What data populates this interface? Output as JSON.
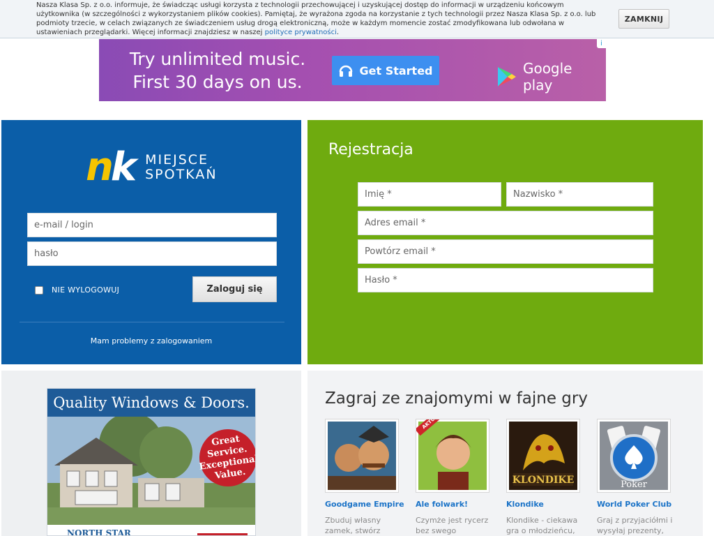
{
  "cookie_bar": {
    "text": "Nasza Klasa Sp. z o.o. informuje, że świadcząc usługi korzysta z technologii przechowującej i uzyskującej dostęp do informacji w urządzeniu końcowym użytkownika (w szczególności z wykorzystaniem plików cookies). Pamiętaj, że wyrażona zgoda na korzystanie z tych technologii przez Nasza Klasa Sp. z o.o. lub podmioty trzecie, w celach związanych ze świadczeniem usług drogą elektroniczną, może w każdym momencie zostać zmodyfikowana lub odwołana w ustawieniach przeglądarki. Więcej informacji znajdziesz w naszej",
    "link": "polityce prywatności",
    "link_suffix": ".",
    "close_label": "ZAMKNIJ"
  },
  "ad_banner": {
    "line1": "Try unlimited music.",
    "line2": "First 30 days on us.",
    "cta": "Get Started",
    "store": "Google play",
    "info_icon": "info-icon"
  },
  "login": {
    "logo_line1": "MIEJSCE",
    "logo_line2": "SPOTKAŃ",
    "email_placeholder": "e-mail / login",
    "password_placeholder": "hasło",
    "remember_label": "NIE WYLOGOWUJ",
    "login_button": "Zaloguj się",
    "problem_link": "Mam problemy z zalogowaniem",
    "colors": {
      "panel": "#0b5ea8",
      "logo_n": "#f5c400"
    }
  },
  "register": {
    "title": "Rejestracja",
    "first_name": "Imię *",
    "last_name": "Nazwisko *",
    "email": "Adres email *",
    "email_repeat": "Powtórz email *",
    "password": "Hasło *",
    "colors": {
      "panel": "#6fab0f"
    }
  },
  "windows_ad": {
    "headline": "Quality Windows & Doors.",
    "badge_line1": "Great",
    "badge_line2": "Service.",
    "badge_line3": "Exceptional",
    "badge_line4": "Value.",
    "brand": "NORTH STAR"
  },
  "games": {
    "title": "Zagraj ze znajomymi w fajne gry",
    "items": [
      {
        "name": "Goodgame Empire",
        "desc": "Zbuduj własny zamek, stwórz",
        "icon": "warrior-icon"
      },
      {
        "name": "Ale folwark!",
        "desc": "Czymże jest rycerz bez swego majątku?",
        "badge": "AKTUALIZACJA",
        "icon": "farmer-icon"
      },
      {
        "name": "Klondike",
        "desc": "Klondike - ciekawa gra o młodzieńcu,",
        "icon": "dragon-icon"
      },
      {
        "name": "World Poker Club",
        "desc": "Graj z przyjaciółmi i wysyłaj prezenty,",
        "icon": "poker-icon"
      }
    ]
  }
}
